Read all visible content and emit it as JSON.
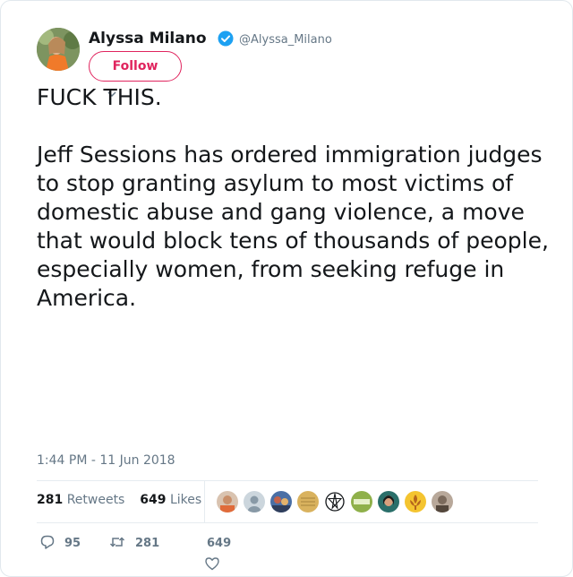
{
  "author": {
    "name": "Alyssa Milano",
    "handle": "@Alyssa_Milano",
    "verified_icon": "verified-badge-icon",
    "avatar": "profile-photo"
  },
  "follow_label": "Follow",
  "tweet": {
    "line1": "FUCK THIS.",
    "body": "Jeff Sessions has ordered immigration judges to stop granting asylum to most victims of domestic abuse and gang violence, a move that would block tens of thousands of people, especially women, from seeking refuge in America."
  },
  "timestamp": "1:44 PM - 11 Jun 2018",
  "stats": {
    "retweets_count": "281",
    "retweets_label": "Retweets",
    "likes_count": "649",
    "likes_label": "Likes"
  },
  "likers": [
    "liker-avatar-1",
    "liker-avatar-2",
    "liker-avatar-3",
    "liker-avatar-4",
    "liker-avatar-5",
    "liker-avatar-6",
    "liker-avatar-7",
    "liker-avatar-8",
    "liker-avatar-9"
  ],
  "actions": {
    "reply_count": "95",
    "retweet_count": "281",
    "like_count": "649"
  },
  "colors": {
    "accent": "#e0245e",
    "verified": "#1da1f2",
    "muted": "#657786",
    "text": "#14171a"
  }
}
